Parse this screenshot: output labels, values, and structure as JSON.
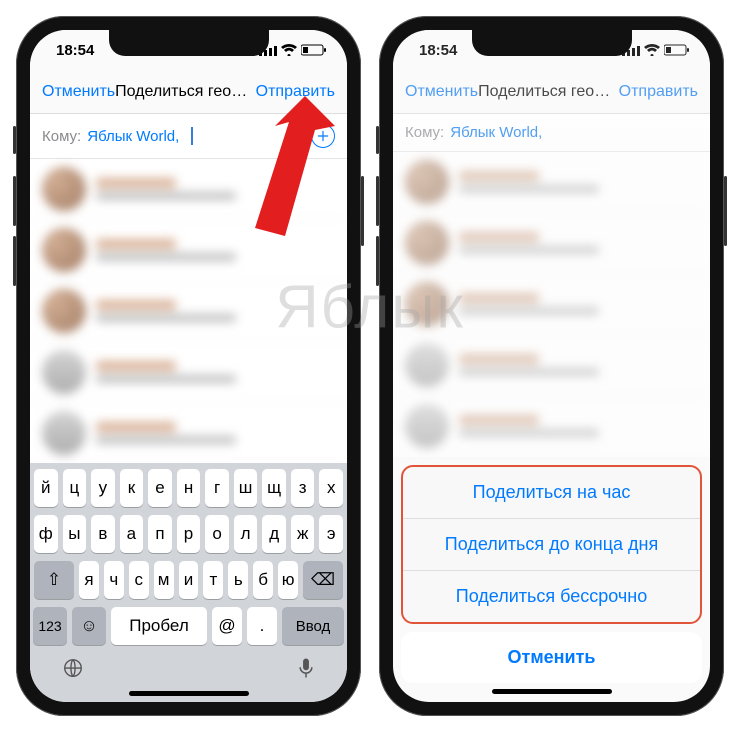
{
  "watermark": "Яблык",
  "status": {
    "time": "18:54",
    "send_icon_label": "location-arrow-icon"
  },
  "nav": {
    "cancel": "Отменить",
    "title": "Поделиться геопози...",
    "send": "Отправить"
  },
  "to_row": {
    "label": "Кому:",
    "recipient": "Яблык World,"
  },
  "keyboard": {
    "row1": [
      "й",
      "ц",
      "у",
      "к",
      "е",
      "н",
      "г",
      "ш",
      "щ",
      "з",
      "х"
    ],
    "row2": [
      "ф",
      "ы",
      "в",
      "а",
      "п",
      "р",
      "о",
      "л",
      "д",
      "ж",
      "э"
    ],
    "row3_letters": [
      "я",
      "ч",
      "с",
      "м",
      "и",
      "т",
      "ь",
      "б",
      "ю"
    ],
    "shift": "⇧",
    "backspace": "⌫",
    "numbers": "123",
    "emoji": "☺",
    "space": "Пробел",
    "at": "@",
    "dot": ".",
    "enter": "Ввод",
    "globe": "🌐",
    "mic": "🎤"
  },
  "sheet": {
    "option1": "Поделиться на час",
    "option2": "Поделиться до конца дня",
    "option3": "Поделиться бессрочно",
    "cancel": "Отменить"
  }
}
